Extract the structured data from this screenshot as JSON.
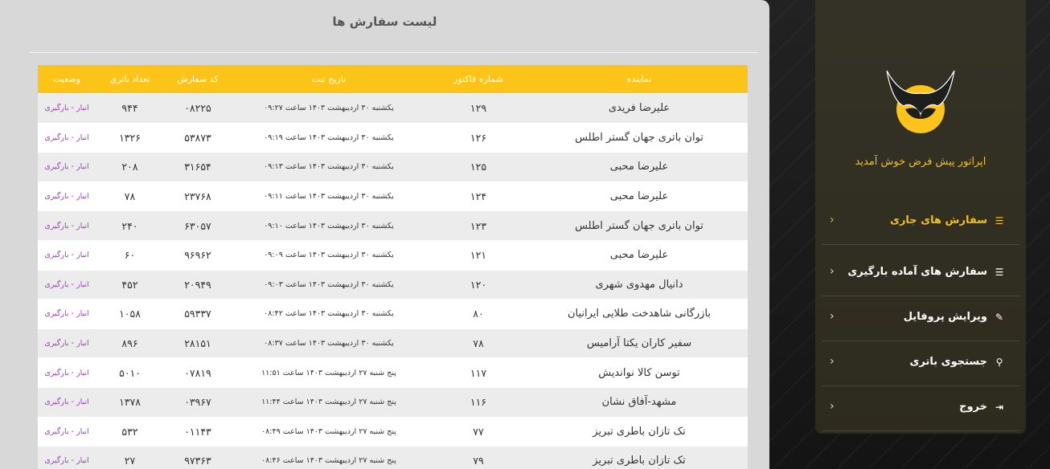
{
  "page_title": "لیست سفارش ها",
  "colors": {
    "accent": "#fcc418",
    "status": "#9a3fb5",
    "menu_active": "#f0c020"
  },
  "table": {
    "headers": [
      "نماینده",
      "شماره فاکتور",
      "تاریخ ثبت",
      "کد سفارش",
      "تعداد باتری",
      "وضعیت"
    ],
    "rows": [
      [
        "علیرضا فریدی",
        "۱۲۹",
        "یکشنبه ۳۰ اردیبهشت ۱۴۰۳ ساعت ۰۹:۲۷",
        "۰۸۲۲۵",
        "۹۴۴",
        "انبار - بارگیری"
      ],
      [
        "توان باتری جهان گستر اطلس",
        "۱۲۶",
        "یکشنبه ۳۰ اردیبهشت ۱۴۰۳ ساعت ۰۹:۱۹",
        "۵۳۸۷۳",
        "۱۳۲۶",
        "انبار - بارگیری"
      ],
      [
        "علیرضا محبی",
        "۱۲۵",
        "یکشنبه ۳۰ اردیبهشت ۱۴۰۳ ساعت ۰۹:۱۳",
        "۳۱۶۵۴",
        "۲۰۸",
        "انبار - بارگیری"
      ],
      [
        "علیرضا محبی",
        "۱۲۴",
        "یکشنبه ۳۰ اردیبهشت ۱۴۰۳ ساعت ۰۹:۱۱",
        "۲۳۷۶۸",
        "۷۸",
        "انبار - بارگیری"
      ],
      [
        "توان باتری جهان گستر اطلس",
        "۱۲۳",
        "یکشنبه ۳۰ اردیبهشت ۱۴۰۳ ساعت ۰۹:۱۰",
        "۶۳۰۵۷",
        "۲۴۰",
        "انبار - بارگیری"
      ],
      [
        "علیرضا محبی",
        "۱۲۱",
        "یکشنبه ۳۰ اردیبهشت ۱۴۰۳ ساعت ۰۹:۰۹",
        "۹۶۹۶۲",
        "۶۰",
        "انبار - بارگیری"
      ],
      [
        "دانیال مهدوی شهری",
        "۱۲۰",
        "یکشنبه ۳۰ اردیبهشت ۱۴۰۳ ساعت ۰۹:۰۳",
        "۲۰۹۴۹",
        "۴۵۲",
        "انبار - بارگیری"
      ],
      [
        "بازرگانی شاهدخت طلایی ایرانیان",
        "۸۰",
        "یکشنبه ۳۰ اردیبهشت ۱۴۰۳ ساعت ۰۸:۴۲",
        "۵۹۳۳۷",
        "۱۰۵۸",
        "انبار - بارگیری"
      ],
      [
        "سفیر کاران یکتا آرامیس",
        "۷۸",
        "یکشنبه ۳۰ اردیبهشت ۱۴۰۳ ساعت ۰۸:۳۷",
        "۲۸۱۵۱",
        "۸۹۶",
        "انبار - بارگیری"
      ],
      [
        "توسن کالا نواندیش",
        "۱۱۷",
        "پنج شنبه ۲۷ اردیبهشت ۱۴۰۳ ساعت ۱۱:۵۱",
        "۰۷۸۱۹",
        "۵۰۱۰",
        "انبار - بارگیری"
      ],
      [
        "مشهد-آفاق نشان",
        "۱۱۶",
        "پنج شنبه ۲۷ اردیبهشت ۱۴۰۳ ساعت ۱۱:۴۴",
        "۰۳۹۶۷",
        "۱۳۷۸",
        "انبار - بارگیری"
      ],
      [
        "تک تازان باطری تبریز",
        "۷۷",
        "پنج شنبه ۲۷ اردیبهشت ۱۴۰۳ ساعت ۰۸:۴۹",
        "۰۱۱۴۳",
        "۵۳۲",
        "انبار - بارگیری"
      ],
      [
        "تک تازان باطری تبریز",
        "۷۹",
        "پنج شنبه ۲۷ اردیبهشت ۱۴۰۳ ساعت ۰۸:۴۶",
        "۹۷۳۶۳",
        "۲۷",
        "انبار - بارگیری"
      ]
    ]
  },
  "sidebar": {
    "welcome": "اپراتور پیش فرض  خوش آمدید",
    "logo_icon": "owl-logo",
    "menu": [
      {
        "label": "سفارش های جاری",
        "icon": "list-icon",
        "glyph": "☰",
        "active": true
      },
      {
        "label": "سفارش های آماده بارگیری",
        "icon": "list-icon",
        "glyph": "☰",
        "active": false
      },
      {
        "label": "ویرایش پروفایل",
        "icon": "user-edit-icon",
        "glyph": "✎",
        "active": false
      },
      {
        "label": "جستجوی باتری",
        "icon": "search-icon",
        "glyph": "⚲",
        "active": false
      },
      {
        "label": "خروج",
        "icon": "logout-icon",
        "glyph": "⇥",
        "active": false
      }
    ]
  }
}
